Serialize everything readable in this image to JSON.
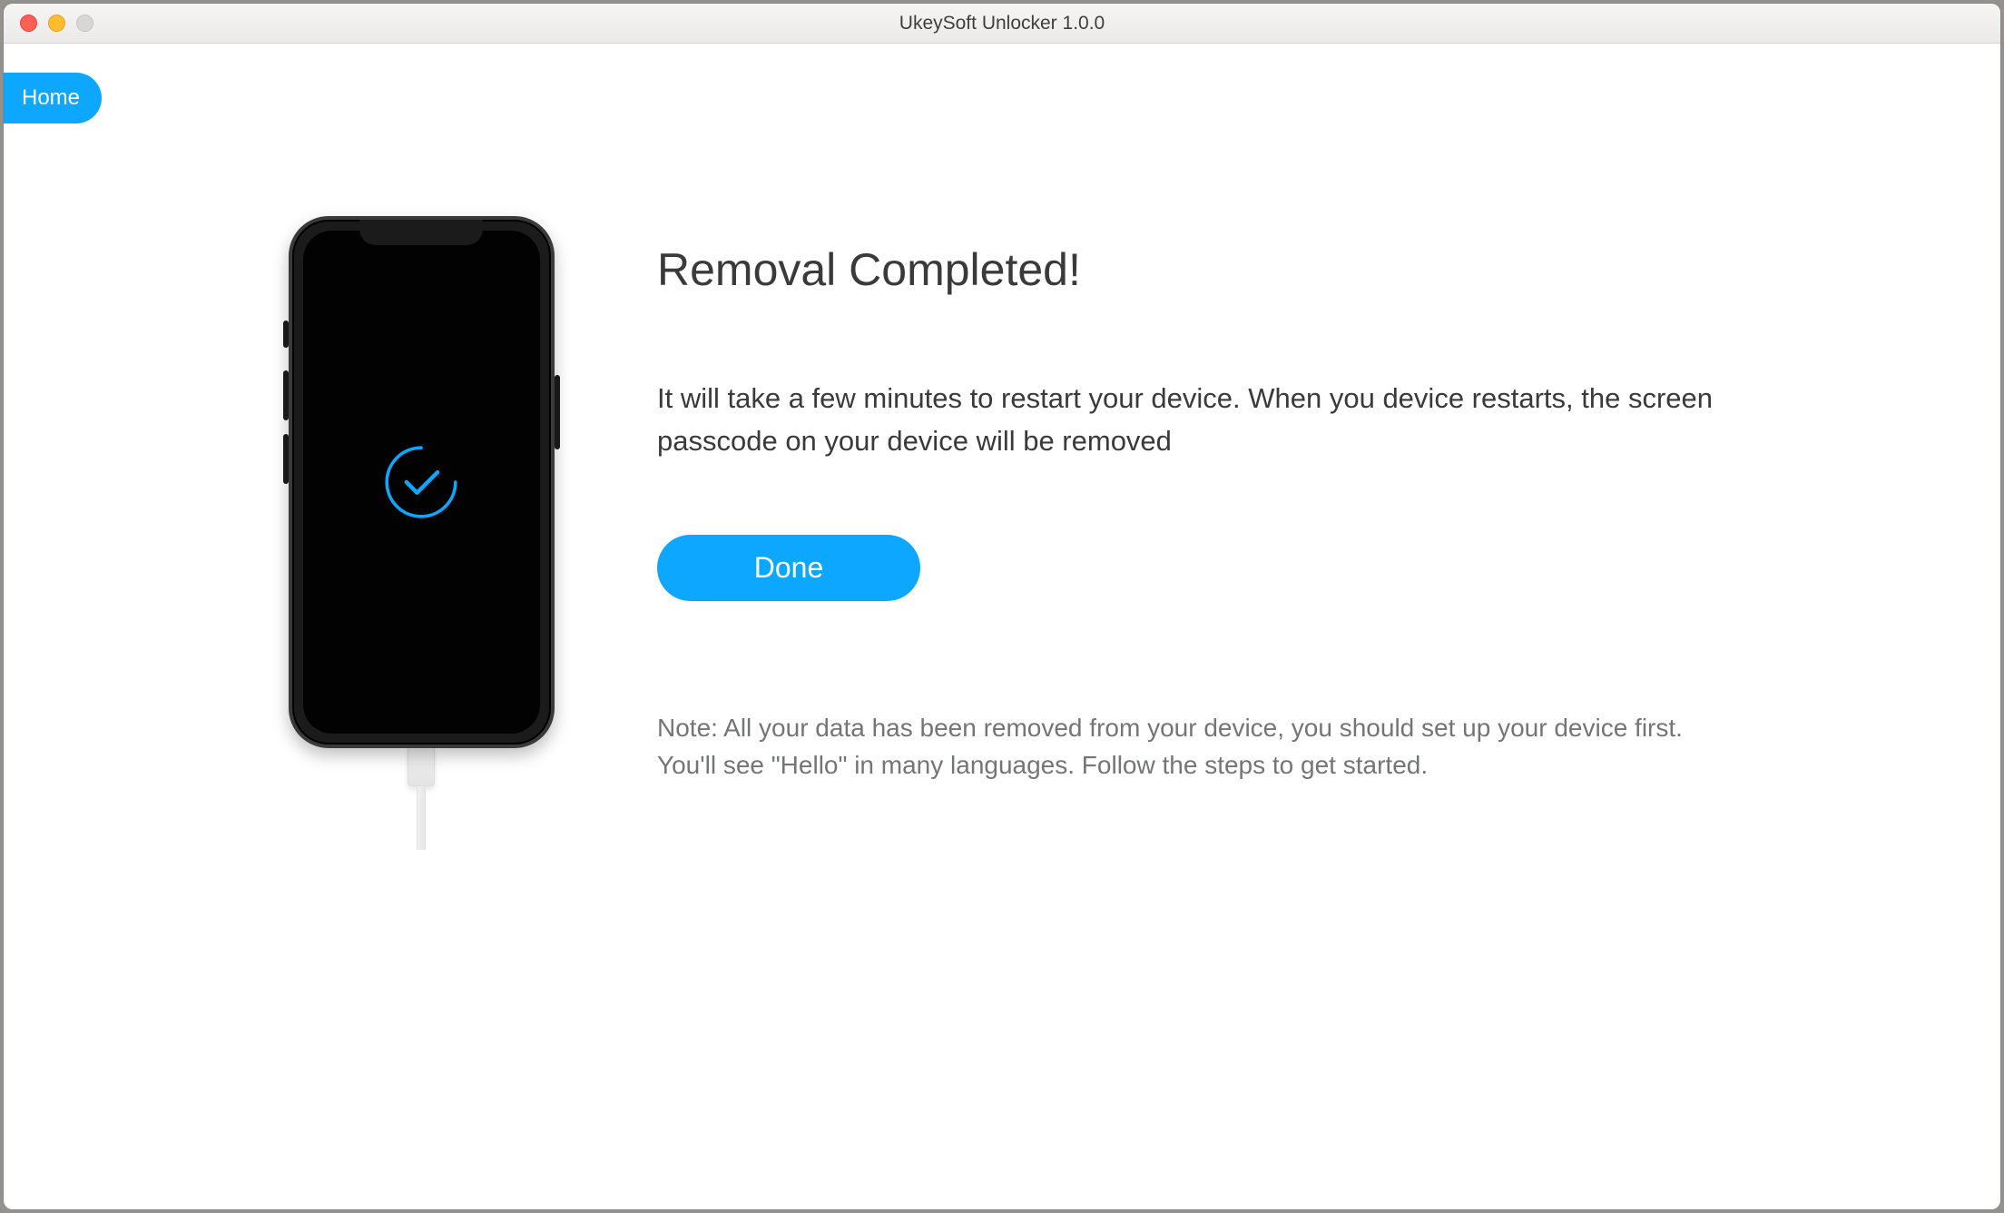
{
  "window": {
    "title": "UkeySoft Unlocker 1.0.0"
  },
  "nav": {
    "home_label": "Home"
  },
  "main": {
    "heading": "Removal Completed!",
    "body": "It will take a few minutes to restart your device. When you device restarts, the screen passcode on your device will be removed",
    "done_label": "Done",
    "note": "Note: All your data has been removed from your device, you should set up your device first. You'll see \"Hello\" in many languages. Follow the steps to get started."
  },
  "colors": {
    "accent": "#0da7ff"
  }
}
